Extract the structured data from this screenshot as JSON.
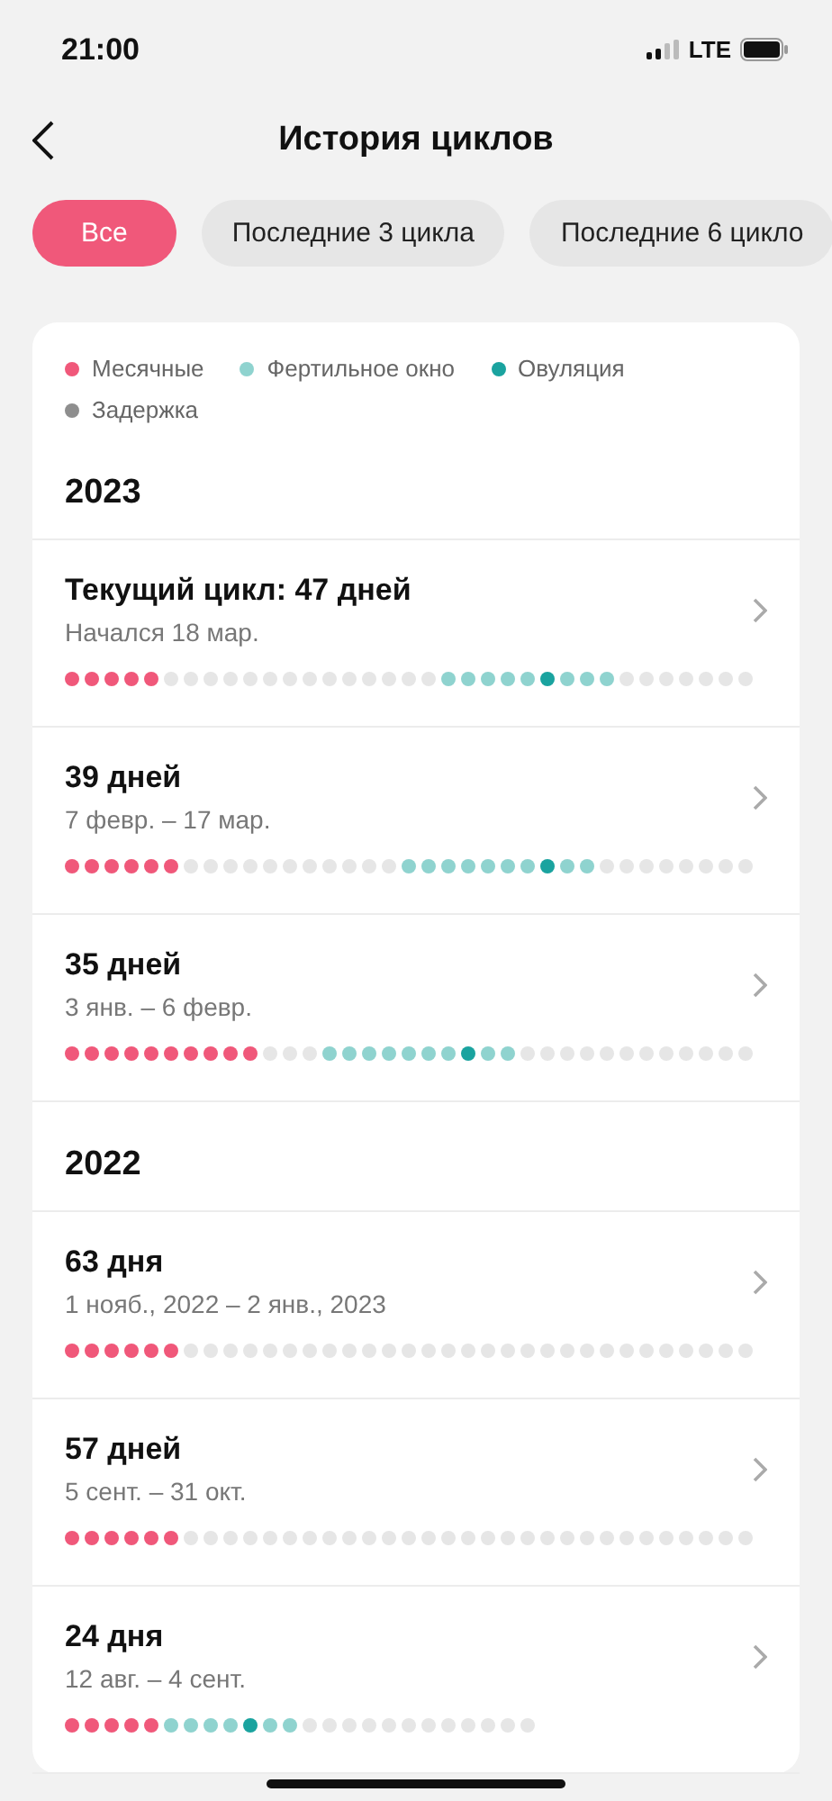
{
  "status_bar": {
    "time": "21:00",
    "network": "LTE"
  },
  "header": {
    "title": "История циклов"
  },
  "filters": [
    {
      "label": "Все",
      "selected": true
    },
    {
      "label": "Последние 3 цикла",
      "selected": false
    },
    {
      "label": "Последние 6 цикло",
      "selected": false
    }
  ],
  "legend": [
    {
      "label": "Месячные",
      "color": "#f0587a"
    },
    {
      "label": "Фертильное окно",
      "color": "#8fd3cf"
    },
    {
      "label": "Овуляция",
      "color": "#1aa39f"
    },
    {
      "label": "Задержка",
      "color": "#8e8e8e"
    }
  ],
  "years": [
    {
      "year": "2023",
      "cycles": [
        {
          "title": "Текущий цикл: 47 дней",
          "dates": "Начался 18 мар.",
          "days": [
            {
              "kind": "period"
            },
            {
              "kind": "period"
            },
            {
              "kind": "period"
            },
            {
              "kind": "period"
            },
            {
              "kind": "period"
            },
            {
              "kind": "none"
            },
            {
              "kind": "none"
            },
            {
              "kind": "none"
            },
            {
              "kind": "none"
            },
            {
              "kind": "none"
            },
            {
              "kind": "none"
            },
            {
              "kind": "none"
            },
            {
              "kind": "none"
            },
            {
              "kind": "none"
            },
            {
              "kind": "none"
            },
            {
              "kind": "none"
            },
            {
              "kind": "none"
            },
            {
              "kind": "none"
            },
            {
              "kind": "none"
            },
            {
              "kind": "fertile"
            },
            {
              "kind": "fertile"
            },
            {
              "kind": "fertile"
            },
            {
              "kind": "fertile"
            },
            {
              "kind": "fertile"
            },
            {
              "kind": "ovulation"
            },
            {
              "kind": "fertile"
            },
            {
              "kind": "fertile"
            },
            {
              "kind": "fertile"
            },
            {
              "kind": "none"
            },
            {
              "kind": "none"
            },
            {
              "kind": "none"
            },
            {
              "kind": "none"
            },
            {
              "kind": "none"
            },
            {
              "kind": "none"
            },
            {
              "kind": "none"
            }
          ]
        },
        {
          "title": "39 дней",
          "dates": "7 февр. – 17 мар.",
          "days": [
            {
              "kind": "period"
            },
            {
              "kind": "period"
            },
            {
              "kind": "period"
            },
            {
              "kind": "period"
            },
            {
              "kind": "period"
            },
            {
              "kind": "period"
            },
            {
              "kind": "none"
            },
            {
              "kind": "none"
            },
            {
              "kind": "none"
            },
            {
              "kind": "none"
            },
            {
              "kind": "none"
            },
            {
              "kind": "none"
            },
            {
              "kind": "none"
            },
            {
              "kind": "none"
            },
            {
              "kind": "none"
            },
            {
              "kind": "none"
            },
            {
              "kind": "none"
            },
            {
              "kind": "fertile"
            },
            {
              "kind": "fertile"
            },
            {
              "kind": "fertile"
            },
            {
              "kind": "fertile"
            },
            {
              "kind": "fertile"
            },
            {
              "kind": "fertile"
            },
            {
              "kind": "fertile"
            },
            {
              "kind": "ovulation"
            },
            {
              "kind": "fertile"
            },
            {
              "kind": "fertile"
            },
            {
              "kind": "none"
            },
            {
              "kind": "none"
            },
            {
              "kind": "none"
            },
            {
              "kind": "none"
            },
            {
              "kind": "none"
            },
            {
              "kind": "none"
            },
            {
              "kind": "none"
            },
            {
              "kind": "none"
            }
          ]
        },
        {
          "title": "35 дней",
          "dates": "3 янв. – 6 февр.",
          "days": [
            {
              "kind": "period"
            },
            {
              "kind": "period"
            },
            {
              "kind": "period"
            },
            {
              "kind": "period"
            },
            {
              "kind": "period"
            },
            {
              "kind": "period"
            },
            {
              "kind": "period"
            },
            {
              "kind": "period"
            },
            {
              "kind": "period"
            },
            {
              "kind": "period"
            },
            {
              "kind": "none"
            },
            {
              "kind": "none"
            },
            {
              "kind": "none"
            },
            {
              "kind": "fertile"
            },
            {
              "kind": "fertile"
            },
            {
              "kind": "fertile"
            },
            {
              "kind": "fertile"
            },
            {
              "kind": "fertile"
            },
            {
              "kind": "fertile"
            },
            {
              "kind": "fertile"
            },
            {
              "kind": "ovulation"
            },
            {
              "kind": "fertile"
            },
            {
              "kind": "fertile"
            },
            {
              "kind": "none"
            },
            {
              "kind": "none"
            },
            {
              "kind": "none"
            },
            {
              "kind": "none"
            },
            {
              "kind": "none"
            },
            {
              "kind": "none"
            },
            {
              "kind": "none"
            },
            {
              "kind": "none"
            },
            {
              "kind": "none"
            },
            {
              "kind": "none"
            },
            {
              "kind": "none"
            },
            {
              "kind": "none"
            }
          ]
        }
      ]
    },
    {
      "year": "2022",
      "cycles": [
        {
          "title": "63 дня",
          "dates": "1 нояб., 2022 – 2 янв., 2023",
          "days": [
            {
              "kind": "period"
            },
            {
              "kind": "period"
            },
            {
              "kind": "period"
            },
            {
              "kind": "period"
            },
            {
              "kind": "period"
            },
            {
              "kind": "period"
            },
            {
              "kind": "none"
            },
            {
              "kind": "none"
            },
            {
              "kind": "none"
            },
            {
              "kind": "none"
            },
            {
              "kind": "none"
            },
            {
              "kind": "none"
            },
            {
              "kind": "none"
            },
            {
              "kind": "none"
            },
            {
              "kind": "none"
            },
            {
              "kind": "none"
            },
            {
              "kind": "none"
            },
            {
              "kind": "none"
            },
            {
              "kind": "none"
            },
            {
              "kind": "none"
            },
            {
              "kind": "none"
            },
            {
              "kind": "none"
            },
            {
              "kind": "none"
            },
            {
              "kind": "none"
            },
            {
              "kind": "none"
            },
            {
              "kind": "none"
            },
            {
              "kind": "none"
            },
            {
              "kind": "none"
            },
            {
              "kind": "none"
            },
            {
              "kind": "none"
            },
            {
              "kind": "none"
            },
            {
              "kind": "none"
            },
            {
              "kind": "none"
            },
            {
              "kind": "none"
            },
            {
              "kind": "none"
            }
          ]
        },
        {
          "title": "57 дней",
          "dates": "5 сент. – 31 окт.",
          "days": [
            {
              "kind": "period"
            },
            {
              "kind": "period"
            },
            {
              "kind": "period"
            },
            {
              "kind": "period"
            },
            {
              "kind": "period"
            },
            {
              "kind": "period"
            },
            {
              "kind": "none"
            },
            {
              "kind": "none"
            },
            {
              "kind": "none"
            },
            {
              "kind": "none"
            },
            {
              "kind": "none"
            },
            {
              "kind": "none"
            },
            {
              "kind": "none"
            },
            {
              "kind": "none"
            },
            {
              "kind": "none"
            },
            {
              "kind": "none"
            },
            {
              "kind": "none"
            },
            {
              "kind": "none"
            },
            {
              "kind": "none"
            },
            {
              "kind": "none"
            },
            {
              "kind": "none"
            },
            {
              "kind": "none"
            },
            {
              "kind": "none"
            },
            {
              "kind": "none"
            },
            {
              "kind": "none"
            },
            {
              "kind": "none"
            },
            {
              "kind": "none"
            },
            {
              "kind": "none"
            },
            {
              "kind": "none"
            },
            {
              "kind": "none"
            },
            {
              "kind": "none"
            },
            {
              "kind": "none"
            },
            {
              "kind": "none"
            },
            {
              "kind": "none"
            },
            {
              "kind": "none"
            }
          ]
        },
        {
          "title": "24 дня",
          "dates": "12 авг. – 4 сент.",
          "days": [
            {
              "kind": "period"
            },
            {
              "kind": "period"
            },
            {
              "kind": "period"
            },
            {
              "kind": "period"
            },
            {
              "kind": "period"
            },
            {
              "kind": "fertile"
            },
            {
              "kind": "fertile"
            },
            {
              "kind": "fertile"
            },
            {
              "kind": "fertile"
            },
            {
              "kind": "ovulation"
            },
            {
              "kind": "fertile"
            },
            {
              "kind": "fertile"
            },
            {
              "kind": "none"
            },
            {
              "kind": "none"
            },
            {
              "kind": "none"
            },
            {
              "kind": "none"
            },
            {
              "kind": "none"
            },
            {
              "kind": "none"
            },
            {
              "kind": "none"
            },
            {
              "kind": "none"
            },
            {
              "kind": "none"
            },
            {
              "kind": "none"
            },
            {
              "kind": "none"
            },
            {
              "kind": "none"
            }
          ]
        }
      ]
    }
  ]
}
